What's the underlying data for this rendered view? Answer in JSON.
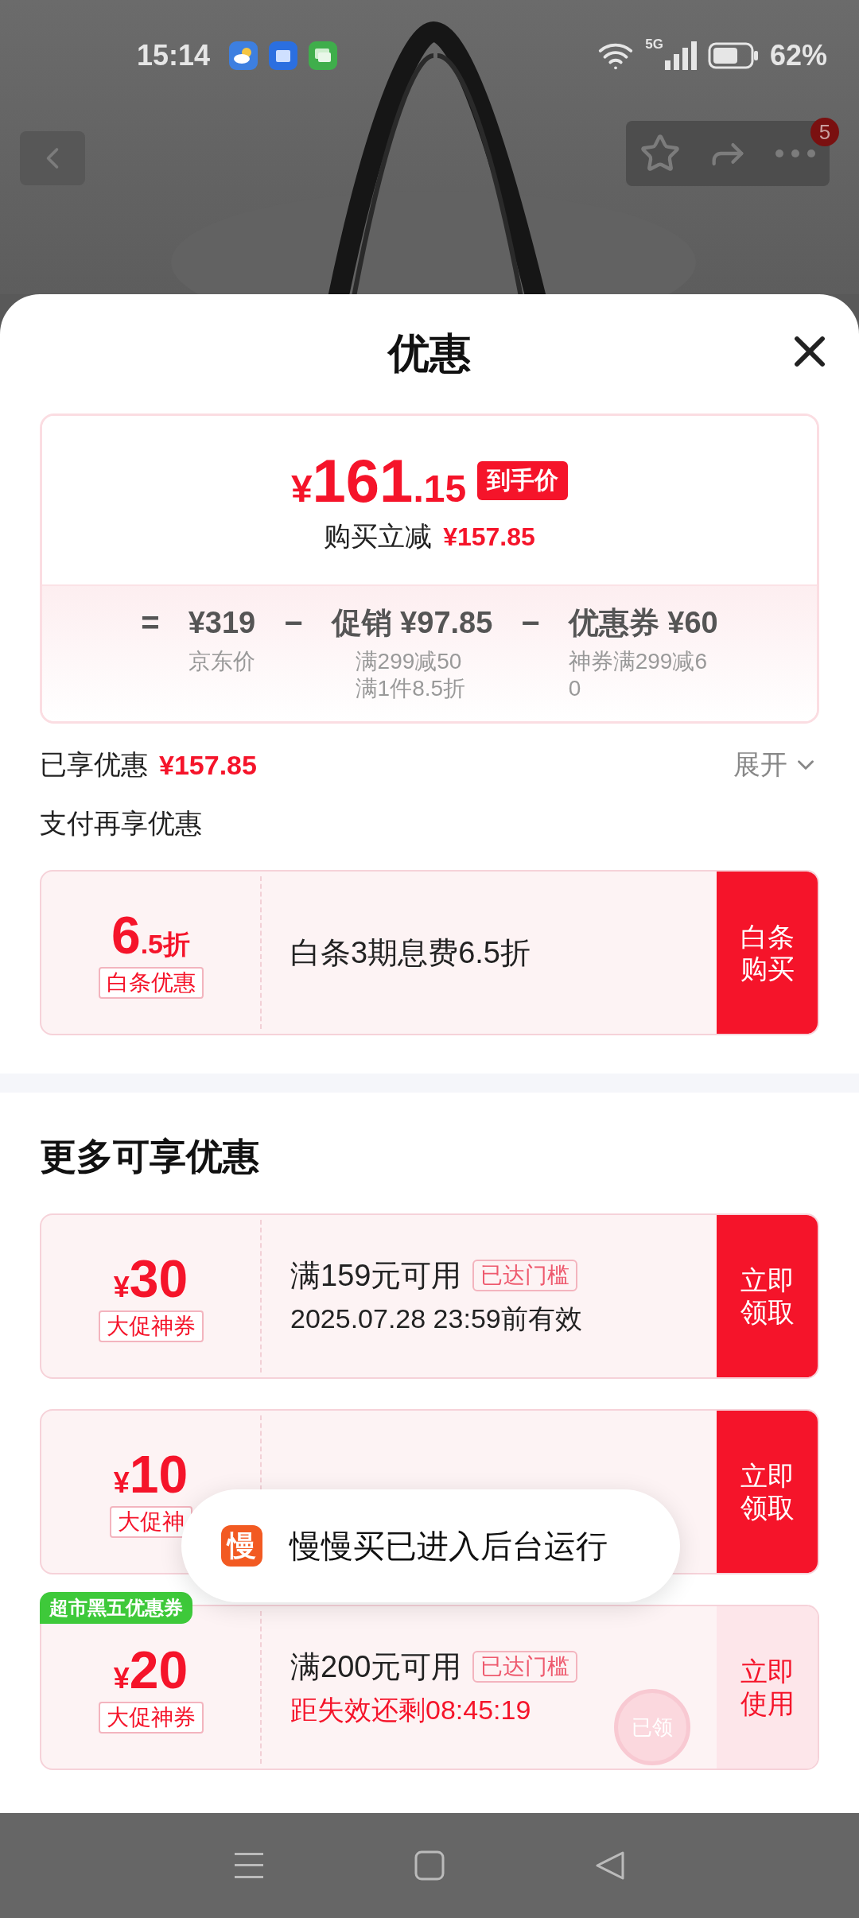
{
  "status_bar": {
    "time": "15:14",
    "network": "5G",
    "battery": "62%"
  },
  "top_bar": {
    "more_badge": "5"
  },
  "sheet": {
    "title": "优惠",
    "final_price": {
      "symbol": "¥",
      "integer": "161",
      "decimal": ".15",
      "label": "到手价"
    },
    "saving": {
      "label": "购买立减",
      "amount": "¥157.85"
    },
    "breakdown": [
      {
        "kind": "op",
        "text": "="
      },
      {
        "kind": "term",
        "value": "¥319",
        "notes": [
          "京东价"
        ]
      },
      {
        "kind": "op",
        "text": "−"
      },
      {
        "kind": "term",
        "value": "促销 ¥97.85",
        "notes": [
          "满299减50",
          "满1件8.5折"
        ]
      },
      {
        "kind": "op",
        "text": "−"
      },
      {
        "kind": "term",
        "value": "优惠券 ¥60",
        "notes": [
          "神券满299减60"
        ]
      }
    ],
    "enjoyed": {
      "label": "已享优惠",
      "amount": "¥157.85",
      "toggle": "展开"
    },
    "pay_section": {
      "title": "支付再享优惠",
      "offer": {
        "big": "6",
        "small": ".5折",
        "tag": "白条优惠",
        "text": "白条3期息费6.5折",
        "button": "白条购买"
      }
    },
    "more_section": {
      "title": "更多可享优惠",
      "coupons": [
        {
          "symbol": "¥",
          "amount": "30",
          "tag": "大促神券",
          "condition": "满159元可用",
          "threshold": "已达门槛",
          "validity": "2025.07.28 23:59前有效",
          "countdown": false,
          "button": "立即领取",
          "claimed": false
        },
        {
          "symbol": "¥",
          "amount": "10",
          "tag": "大促神",
          "button": "立即领取",
          "claimed": false
        },
        {
          "corner_badge": "超市黑五优惠券",
          "symbol": "¥",
          "amount": "20",
          "tag": "大促神券",
          "condition": "满200元可用",
          "threshold": "已达门槛",
          "validity": "距失效还剩08:45:19",
          "countdown": true,
          "button": "立即使用",
          "claimed": true,
          "stamp": "已领"
        }
      ]
    }
  },
  "toast": {
    "icon_char": "慢",
    "text": "慢慢买已进入后台运行"
  }
}
